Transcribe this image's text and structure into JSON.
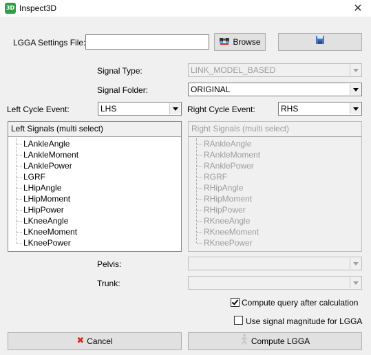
{
  "window": {
    "title": "Inspect3D",
    "app_icon_text": "3D"
  },
  "settings_file": {
    "label": "LGGA Settings File:",
    "value": "",
    "browse_label": "Browse"
  },
  "signal_type": {
    "label": "Signal Type:",
    "value": "LINK_MODEL_BASED"
  },
  "signal_folder": {
    "label": "Signal Folder:",
    "value": "ORIGINAL"
  },
  "left_cycle": {
    "label": "Left Cycle Event:",
    "value": "LHS"
  },
  "right_cycle": {
    "label": "Right Cycle Event:",
    "value": "RHS"
  },
  "left_signals": {
    "header": "Left Signals (multi select)",
    "items": [
      "LAnkleAngle",
      "LAnkleMoment",
      "LAnklePower",
      "LGRF",
      "LHipAngle",
      "LHipMoment",
      "LHipPower",
      "LKneeAngle",
      "LKneeMoment",
      "LKneePower"
    ]
  },
  "right_signals": {
    "header": "Right Signals (multi select)",
    "items": [
      "RAnkleAngle",
      "RAnkleMoment",
      "RAnklePower",
      "RGRF",
      "RHipAngle",
      "RHipMoment",
      "RHipPower",
      "RKneeAngle",
      "RKneeMoment",
      "RKneePower"
    ]
  },
  "pelvis": {
    "label": "Pelvis:",
    "value": ""
  },
  "trunk": {
    "label": "Trunk:",
    "value": ""
  },
  "options": {
    "compute_query": {
      "label": "Compute query after calculation",
      "checked": true
    },
    "signal_magnitude": {
      "label": "Use signal magnitude for LGGA",
      "checked": false
    }
  },
  "buttons": {
    "cancel": "Cancel",
    "compute": "Compute LGGA"
  }
}
